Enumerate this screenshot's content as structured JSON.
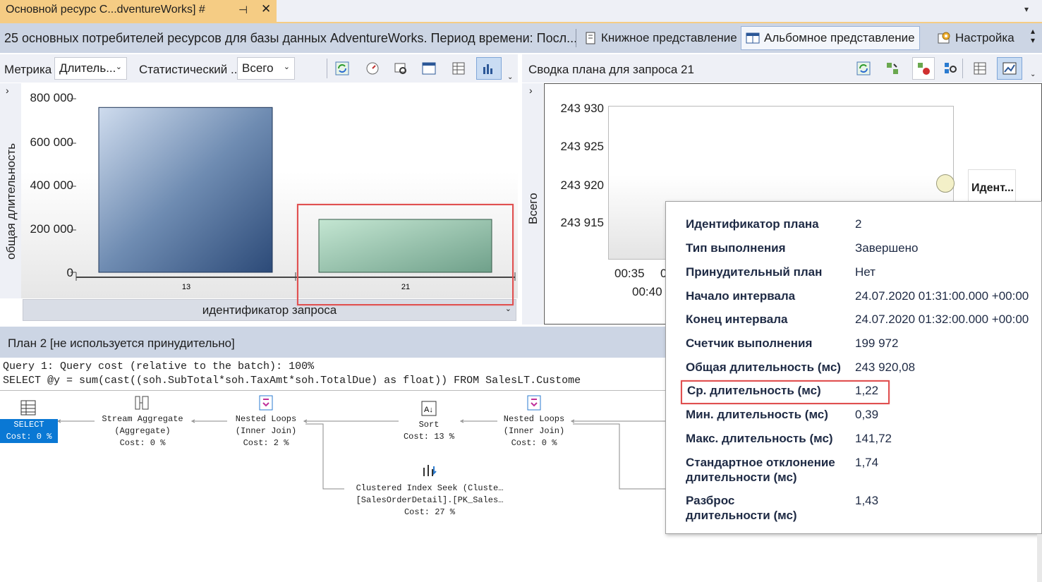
{
  "document_tab": {
    "title": "Основной ресурс С...dventureWorks]",
    "pin_icon": "#",
    "pin_glyph": "⊣",
    "close_glyph": "✕"
  },
  "report": {
    "title": "25 основных потребителей ресурсов для базы данных AdventureWorks. Период времени: Посл...",
    "portrait_label": "Книжное представление",
    "landscape_label": "Альбомное представление",
    "settings_label": "Настройка"
  },
  "left_toolbar": {
    "metric_label": "Метрика",
    "metric_value": "Длитель...",
    "statistic_label": "Статистический ...",
    "statistic_value": "Всего"
  },
  "right_toolbar": {
    "title": "Сводка плана для запроса 21"
  },
  "chart_data": [
    {
      "type": "bar",
      "categories": [
        "13",
        "21"
      ],
      "values": [
        760000,
        243920
      ],
      "xlabel": "идентификатор запроса",
      "ylabel": "общая длительность",
      "yticks": [
        "800 000",
        "600 000",
        "400 000",
        "200 000",
        "0"
      ],
      "ylim": [
        0,
        820000
      ],
      "colors": [
        "#4a6a94",
        "#8fc0a6"
      ]
    },
    {
      "type": "scatter",
      "ylabel": "Всего",
      "yticks": [
        "243 930",
        "243 925",
        "243 920",
        "243 915"
      ],
      "xticks": [
        "00:35",
        "00:40"
      ],
      "points": [
        {
          "y": 243920
        }
      ],
      "legend_label": "Идент..."
    }
  ],
  "plan": {
    "title": "План 2 [не используется принудительно]",
    "query_line1": "Query 1: Query cost (relative to the batch): 100%",
    "query_line2": "SELECT @y = sum(cast((soh.SubTotal*soh.TaxAmt*soh.TotalDue) as float)) FROM SalesLT.Custome",
    "nodes": {
      "select": {
        "line1": "SELECT",
        "line2": "Cost: 0 %"
      },
      "stream_agg": {
        "line1": "Stream Aggregate",
        "line2": "(Aggregate)",
        "line3": "Cost: 0 %"
      },
      "nested1": {
        "line1": "Nested Loops",
        "line2": "(Inner Join)",
        "line3": "Cost: 2 %"
      },
      "sort": {
        "line1": "Sort",
        "line2": "Cost: 13 %"
      },
      "nested2": {
        "line1": "Nested Loops",
        "line2": "(Inner Join)",
        "line3": "Cost: 0 %"
      },
      "seek": {
        "line1": "Clustered Index Seek (Cluste…",
        "line2": "[SalesOrderDetail].[PK_Sales…",
        "line3": "Cost: 27 %"
      }
    }
  },
  "tooltip": {
    "rows": [
      {
        "label": "Идентификатор плана",
        "value": "2"
      },
      {
        "label": "Тип выполнения",
        "value": "Завершено"
      },
      {
        "label": "Принудительный план",
        "value": "Нет"
      },
      {
        "label": "Начало интервала",
        "value": "24.07.2020 01:31:00.000 +00:00"
      },
      {
        "label": "Конец интервала",
        "value": "24.07.2020 01:32:00.000 +00:00"
      },
      {
        "label": "Счетчик выполнения",
        "value": "199 972"
      },
      {
        "label": "Общая длительность (мс)",
        "value": "243 920,08"
      },
      {
        "label": "Ср. длительность (мс)",
        "value": "1,22"
      },
      {
        "label": "Мин. длительность (мс)",
        "value": "0,39"
      },
      {
        "label": "Макс. длительность (мс)",
        "value": "141,72"
      },
      {
        "label": "Стандартное отклонение длительности (мс)",
        "label_line1": "Стандартное отклонение",
        "label_line2": "длительности (мс)",
        "value": "1,74"
      },
      {
        "label": "Разброс длительности (мс)",
        "label_line1": "Разброс",
        "label_line2": "длительности (мс)",
        "value": "1,43"
      }
    ]
  }
}
